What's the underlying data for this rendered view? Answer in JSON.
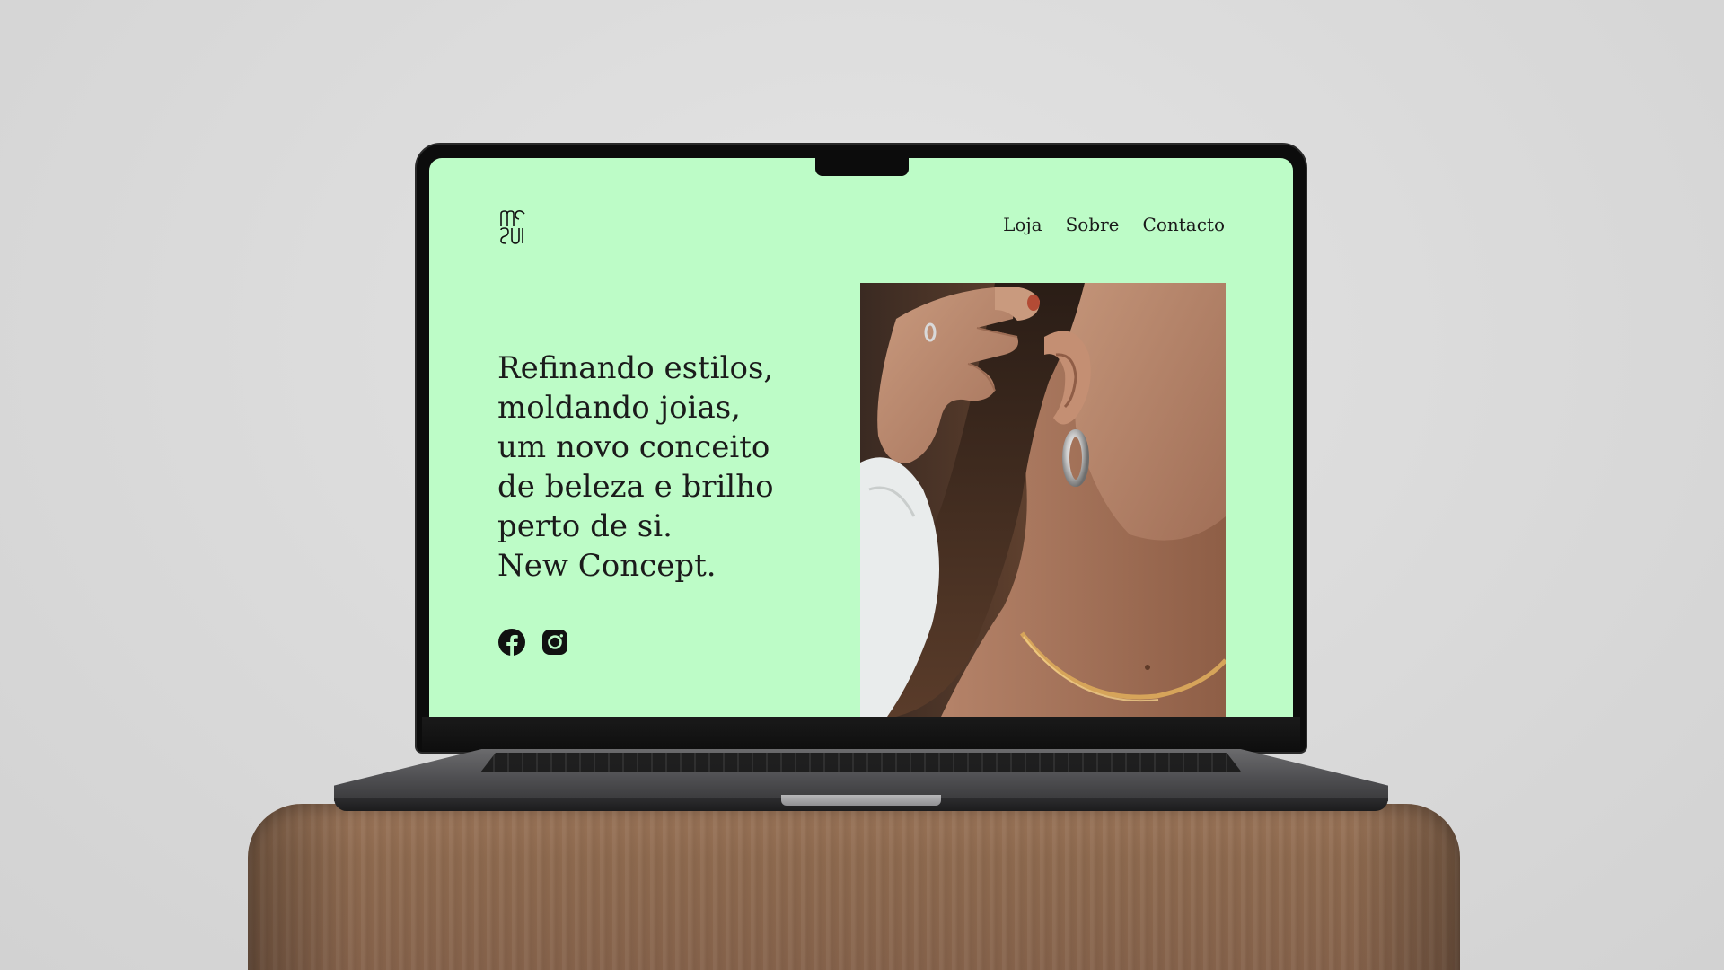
{
  "site": {
    "logo_text": "MS",
    "nav": {
      "items": [
        {
          "label": "Loja"
        },
        {
          "label": "Sobre"
        },
        {
          "label": "Contacto"
        }
      ]
    },
    "hero": {
      "lines": [
        "Refinando estilos,",
        "moldando joias,",
        "um novo conceito",
        "de beleza e brilho",
        "perto de si.",
        "New Concept."
      ]
    },
    "social": [
      {
        "icon": "facebook-icon"
      },
      {
        "icon": "instagram-icon"
      }
    ]
  },
  "colors": {
    "screen_background": "#bdfcc7",
    "text": "#1b1b1b",
    "scene_background": "#dcdcdc",
    "wood": "#8e6a4f"
  }
}
